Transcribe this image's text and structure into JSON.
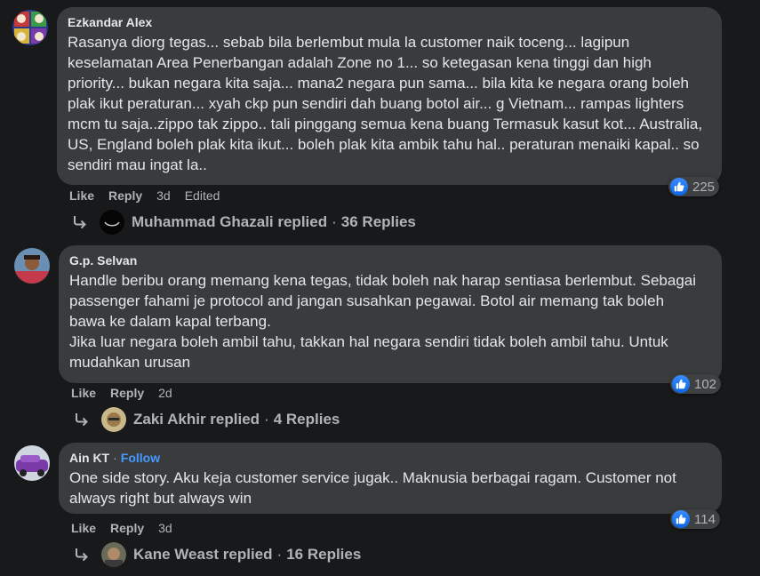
{
  "comments": [
    {
      "author": "Ezkandar Alex",
      "lines": [
        "Rasanya diorg tegas... sebab bila berlembut mula la customer naik toceng... lagipun",
        "keselamatan Area Penerbangan adalah Zone no 1... so ketegasan kena tinggi dan high",
        "priority... bukan negara kita saja... mana2 negara pun sama... bila kita ke negara orang boleh",
        "plak ikut peraturan... xyah ckp pun sendiri dah buang botol air... g Vietnam... rampas lighters",
        "mcm tu saja..zippo tak zippo.. tali pinggang semua kena buang Termasuk kasut kot... Australia,",
        "US, England boleh plak kita ikut... boleh plak kita ambik tahu hal.. peraturan menaiki kapal.. so",
        "sendiri mau ingat la.."
      ],
      "like_label": "Like",
      "reply_label": "Reply",
      "time": "3d",
      "edited": "Edited",
      "reaction_count": "225",
      "reply_author": "Muhammad Ghazali replied",
      "reply_sep": "·",
      "reply_count": "36 Replies"
    },
    {
      "author": "G.p. Selvan",
      "lines": [
        "Handle beribu orang memang kena tegas, tidak boleh nak harap sentiasa berlembut. Sebagai",
        "passenger fahami je protocol and jangan susahkan pegawai. Botol air memang tak boleh",
        "bawa ke dalam kapal terbang.",
        "Jika luar negara boleh ambil tahu, takkan hal negara sendiri tidak boleh ambil tahu. Untuk",
        "mudahkan urusan"
      ],
      "like_label": "Like",
      "reply_label": "Reply",
      "time": "2d",
      "reaction_count": "102",
      "reply_author": "Zaki Akhir replied",
      "reply_sep": "·",
      "reply_count": "4 Replies"
    },
    {
      "author": "Ain KT",
      "author_sep": "·",
      "follow": "Follow",
      "lines": [
        "One side story. Aku keja customer service jugak.. Maknusia berbagai ragam. Customer not",
        "always right but always win"
      ],
      "like_label": "Like",
      "reply_label": "Reply",
      "time": "3d",
      "reaction_count": "114",
      "reply_author": "Kane Weast replied",
      "reply_sep": "·",
      "reply_count": "16 Replies"
    }
  ],
  "colors": {
    "background": "#18191a",
    "bubble": "#3a3b3c",
    "text": "#e4e6eb",
    "secondary": "#b0b3b8",
    "link": "#4599ff",
    "like_blue": "#0a66e6"
  },
  "icons": [
    "thumbs-up-icon",
    "reply-arrow-icon"
  ]
}
